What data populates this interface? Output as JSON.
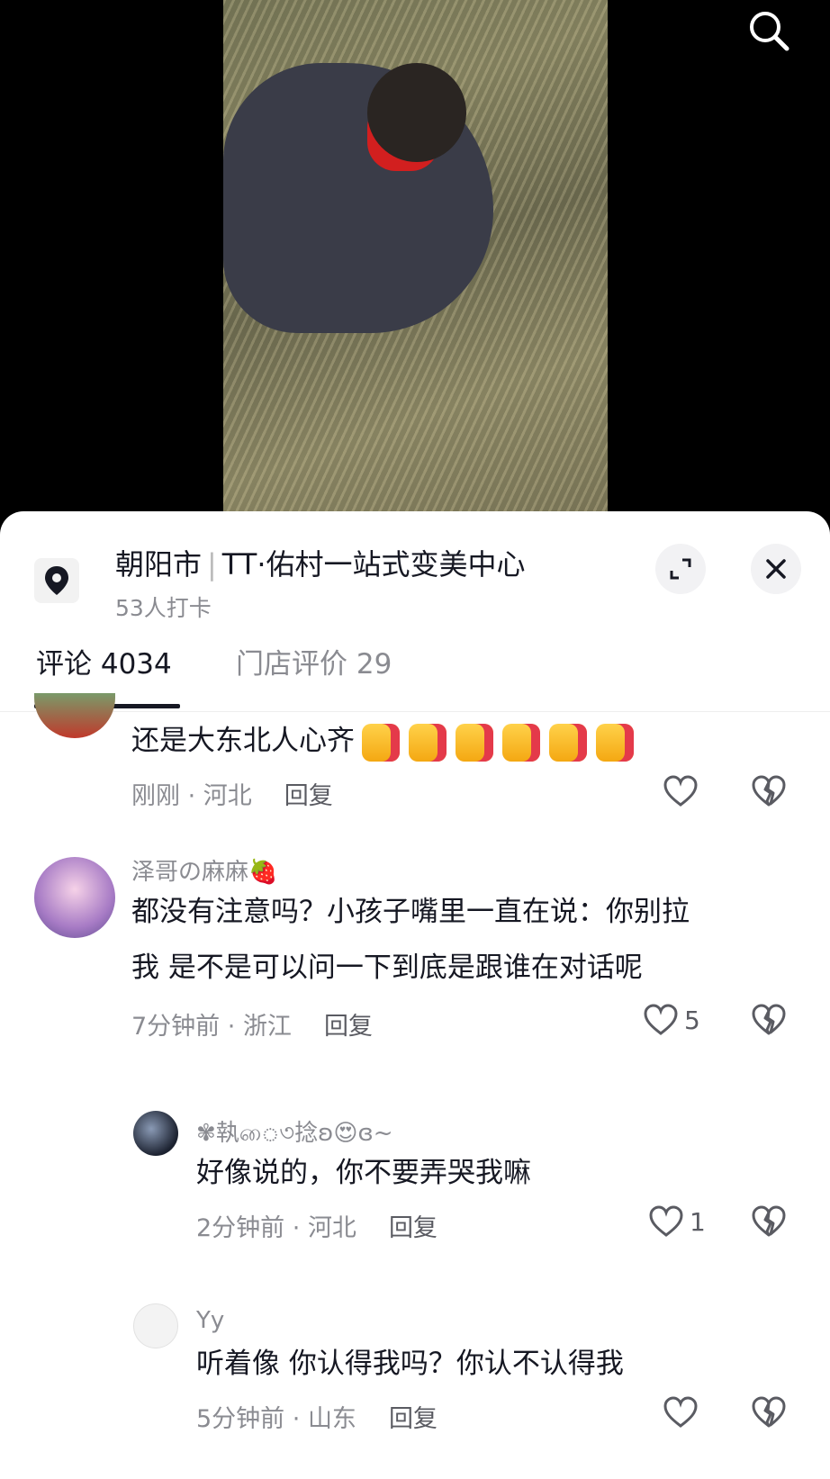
{
  "video": {
    "search_icon": "search-icon"
  },
  "location": {
    "city": "朝阳市",
    "name": "TT·佑村一站式变美中心",
    "checkins": "53人打卡"
  },
  "tabs": [
    {
      "label": "评论 4034",
      "active": true
    },
    {
      "label": "门店评价 29",
      "active": false
    }
  ],
  "comments": [
    {
      "username": "",
      "text": "还是大东北人心齐",
      "emoji": "thumbs-up x6",
      "time": "刚刚",
      "region": "河北",
      "reply_label": "回复",
      "likes": ""
    },
    {
      "username": "泽哥の麻麻🍓",
      "text_line1": "都没有注意吗？小孩子嘴里一直在说：你别拉",
      "text_line2": "我   是不是可以问一下到底是跟谁在对话呢",
      "time": "7分钟前",
      "region": "浙江",
      "reply_label": "回复",
      "likes": "5"
    },
    {
      "username": "✾執ை৩捻ʚ😍ɞ~",
      "text": "好像说的，你不要弄哭我嘛",
      "time": "2分钟前",
      "region": "河北",
      "reply_label": "回复",
      "likes": "1"
    },
    {
      "username": "Yy",
      "text": "听着像 你认得我吗？你认不认得我",
      "time": "5分钟前",
      "region": "山东",
      "reply_label": "回复",
      "likes": ""
    }
  ],
  "colors": {
    "accent_red": "#d21f1f",
    "text": "#161823",
    "muted": "#8a8b91"
  }
}
